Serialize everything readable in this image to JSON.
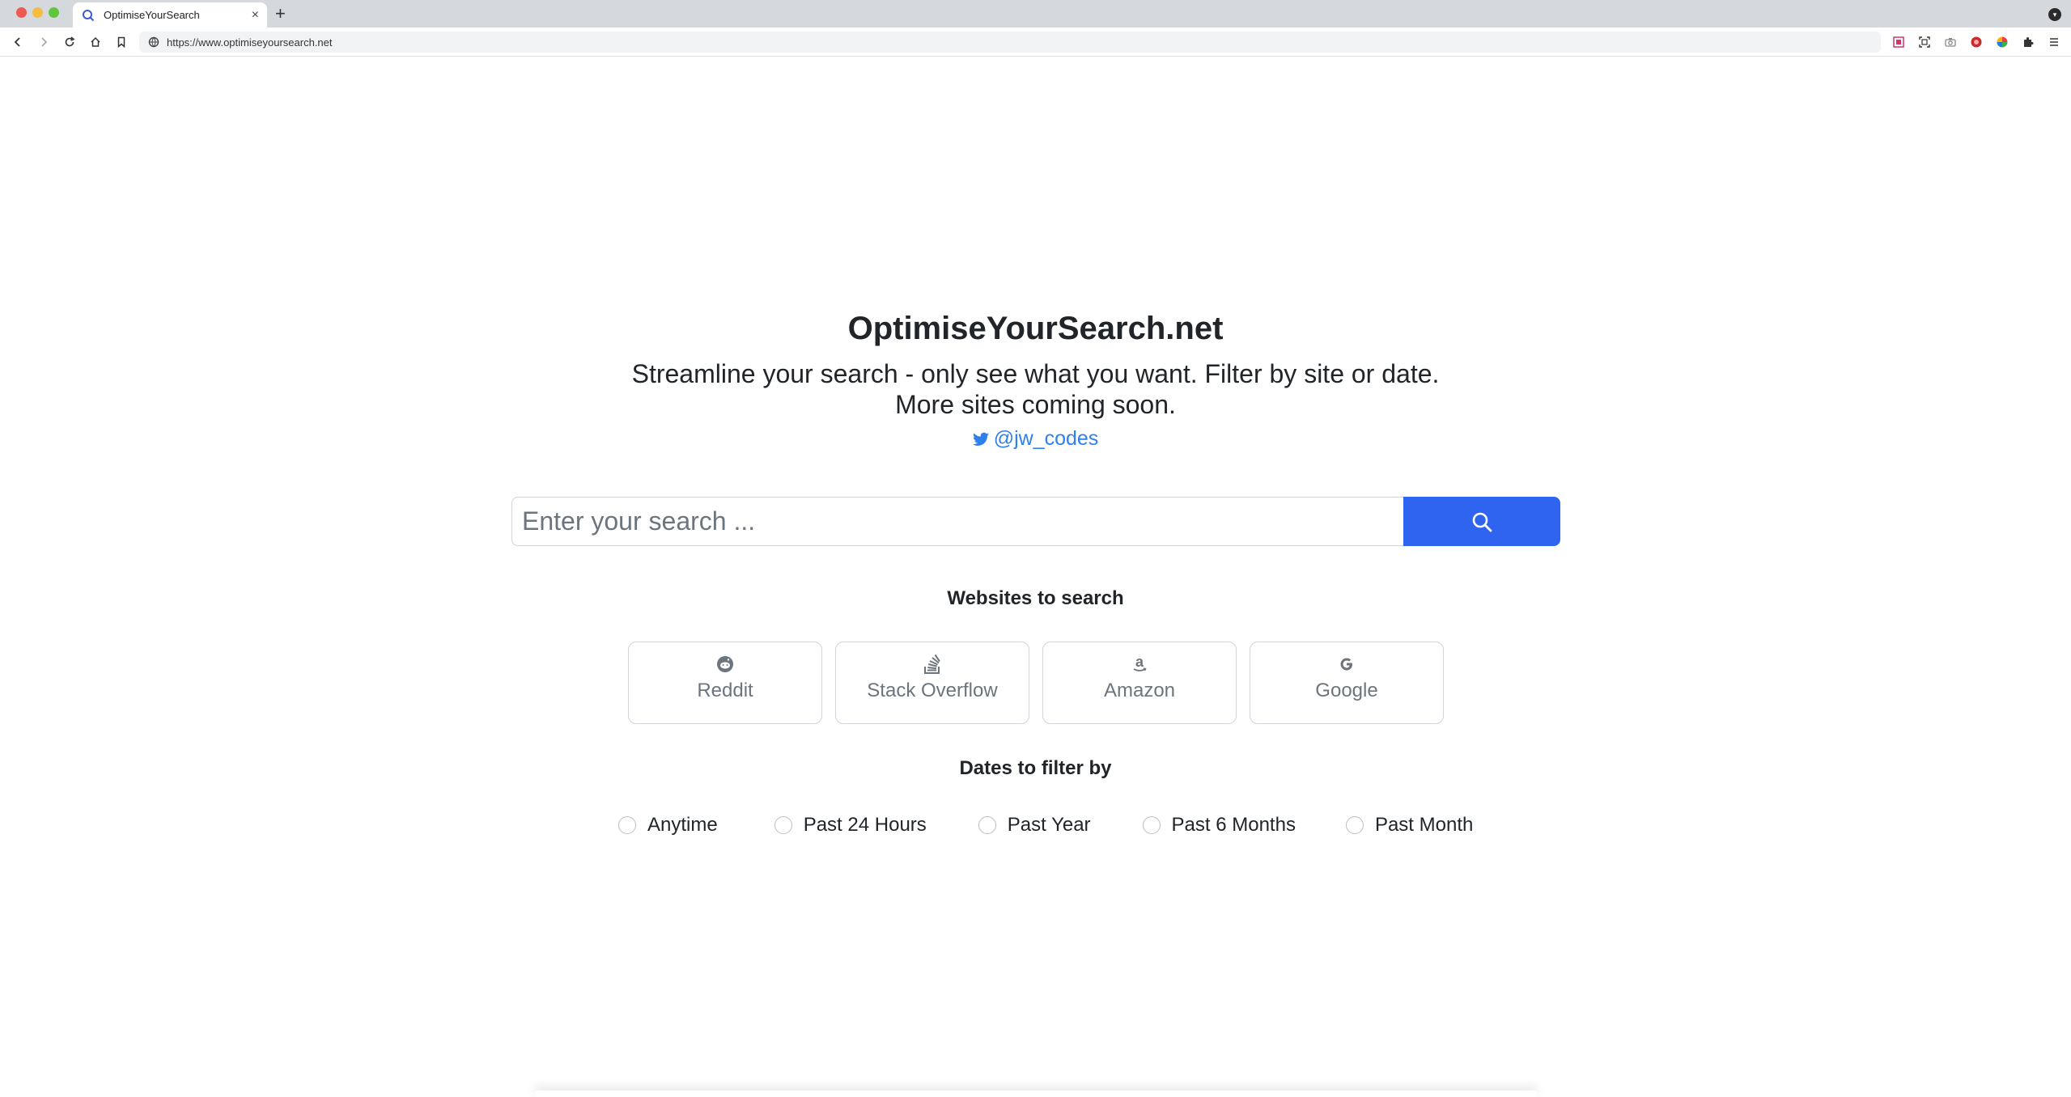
{
  "browser": {
    "tab_title": "OptimiseYourSearch",
    "new_tab_symbol": "+",
    "close_symbol": "×",
    "url": "https://www.optimiseyoursearch.net"
  },
  "page": {
    "title": "OptimiseYourSearch.net",
    "tagline_line1": "Streamline your search - only see what you want. Filter by site or date.",
    "tagline_line2": "More sites coming soon.",
    "twitter_handle": "@jw_codes",
    "search_placeholder": "Enter your search ...",
    "sites_heading": "Websites to search",
    "sites": [
      {
        "label": "Reddit",
        "icon": "reddit-icon"
      },
      {
        "label": "Stack Overflow",
        "icon": "stack-overflow-icon"
      },
      {
        "label": "Amazon",
        "icon": "amazon-icon"
      },
      {
        "label": "Google",
        "icon": "google-icon"
      }
    ],
    "dates_heading": "Dates to filter by",
    "dates": [
      {
        "label": "Anytime"
      },
      {
        "label": "Past 24 Hours"
      },
      {
        "label": "Past Year"
      },
      {
        "label": "Past 6 Months"
      },
      {
        "label": "Past Month"
      }
    ]
  },
  "colors": {
    "accent": "#2f64f0",
    "link": "#2f80ed",
    "text": "#212529",
    "muted": "#6c757d",
    "border": "#d0d4d8"
  }
}
